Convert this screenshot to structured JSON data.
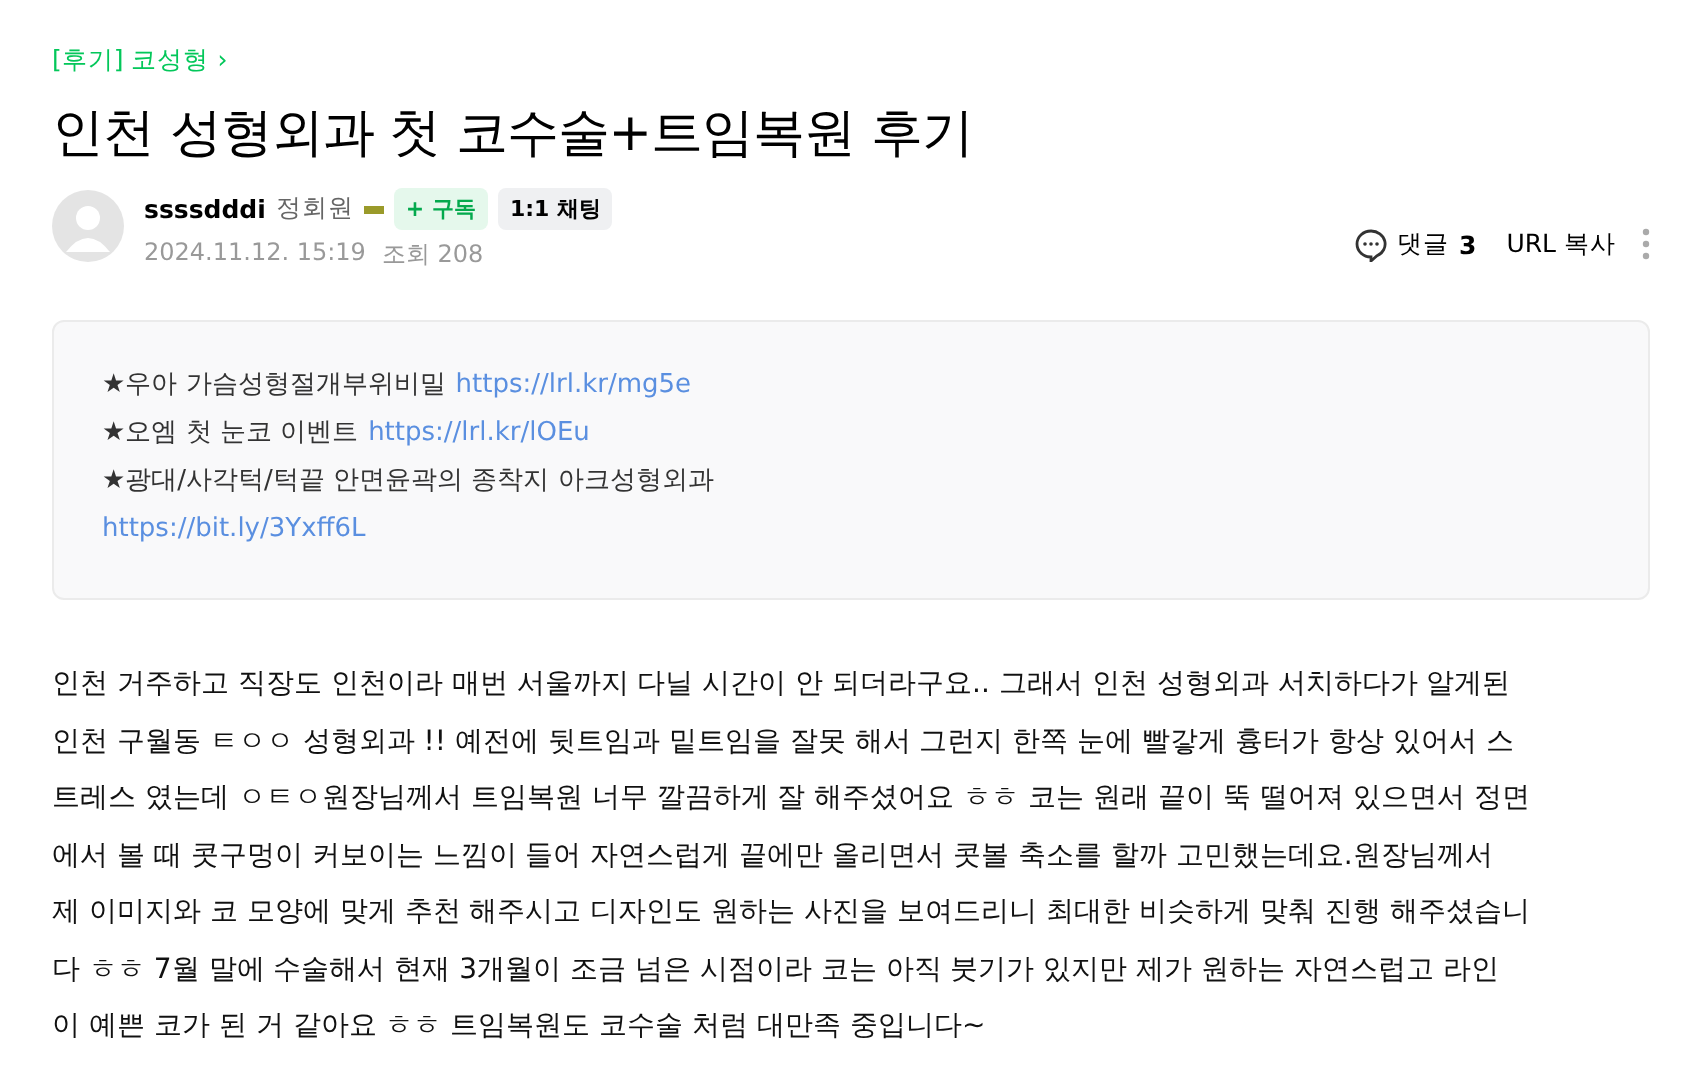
{
  "board": {
    "link": "[후기] 코성형",
    "chevron": "›"
  },
  "title": "인천 성형외과 첫 코수술+트임복원 후기",
  "author": {
    "name": "ssssdddi",
    "grade": "정회원",
    "subscribe": "+ 구독",
    "chat": "1:1 채팅",
    "date": "2024.11.12. 15:19",
    "views": "조회 208"
  },
  "actions": {
    "comments_label": "댓글",
    "comments_count": "3",
    "url_copy": "URL 복사"
  },
  "notice": [
    {
      "text": "★우아 가슴성형절개부위비밀",
      "link": "https://lrl.kr/mg5e"
    },
    {
      "text": "★오엠 첫 눈코 이벤트",
      "link": "https://lrl.kr/lOEu"
    },
    {
      "text": "★광대/사각턱/턱끝 안면윤곽의 종착지 아크성형외과"
    },
    {
      "link": "https://bit.ly/3Yxff6L"
    }
  ],
  "body": [
    "인천 거주하고 직장도 인천이라 매번 서울까지 다닐 시간이 안 되더라구요.. 그래서 인천 성형외과 서치하다가 알게된",
    "인천 구월동 ㅌㅇㅇ 성형외과 !! 예전에 뒷트임과 밑트임을 잘못 해서 그런지 한쪽 눈에 빨갛게 흉터가 항상 있어서 스",
    "트레스 였는데 ㅇㅌㅇ원장님께서 트임복원 너무 깔끔하게 잘 해주셨어요 ㅎㅎ 코는 원래 끝이 뚝 떨어져 있으면서 정면",
    "에서 볼 때 콧구멍이 커보이는 느낌이 들어 자연스럽게 끝에만 올리면서 콧볼 축소를 할까 고민했는데요.원장님께서",
    "제 이미지와 코 모양에 맞게 추천 해주시고 디자인도 원하는 사진을 보여드리니 최대한 비슷하게 맞춰 진행 해주셨습니",
    "다 ㅎㅎ 7월 말에 수술해서 현재 3개월이 조금 넘은 시점이라 코는 아직 붓기가 있지만 제가 원하는 자연스럽고 라인",
    "이 예쁜 코가 된 거 같아요 ㅎㅎ 트임복원도 코수술 처럼 대만족 중입니다~"
  ]
}
